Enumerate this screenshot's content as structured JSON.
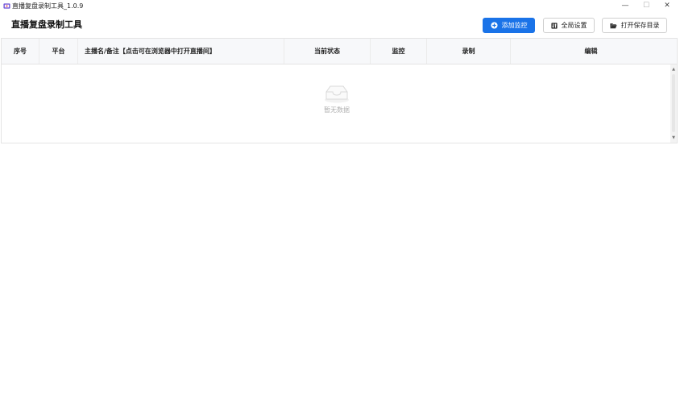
{
  "window": {
    "title": "直播复盘录制工具_1.0.9",
    "minimize_glyph": "—",
    "maximize_glyph": "☐",
    "close_glyph": "✕"
  },
  "header": {
    "title": "直播复盘录制工具",
    "add_button": "添加监控",
    "settings_button": "全局设置",
    "open_folder_button": "打开保存目录"
  },
  "table": {
    "columns": [
      "序号",
      "平台",
      "主播名/备注【点击可在浏览器中打开直播间】",
      "当前状态",
      "监控",
      "录制",
      "编辑"
    ],
    "empty_text": "暂无数据"
  },
  "colors": {
    "accent": "#1a73e8",
    "header_bg": "#f7f8fa"
  },
  "icons": {
    "app": "app-icon",
    "add": "plus-circle-icon",
    "settings": "settings-icon",
    "folder": "folder-open-icon",
    "empty": "empty-box-icon"
  }
}
